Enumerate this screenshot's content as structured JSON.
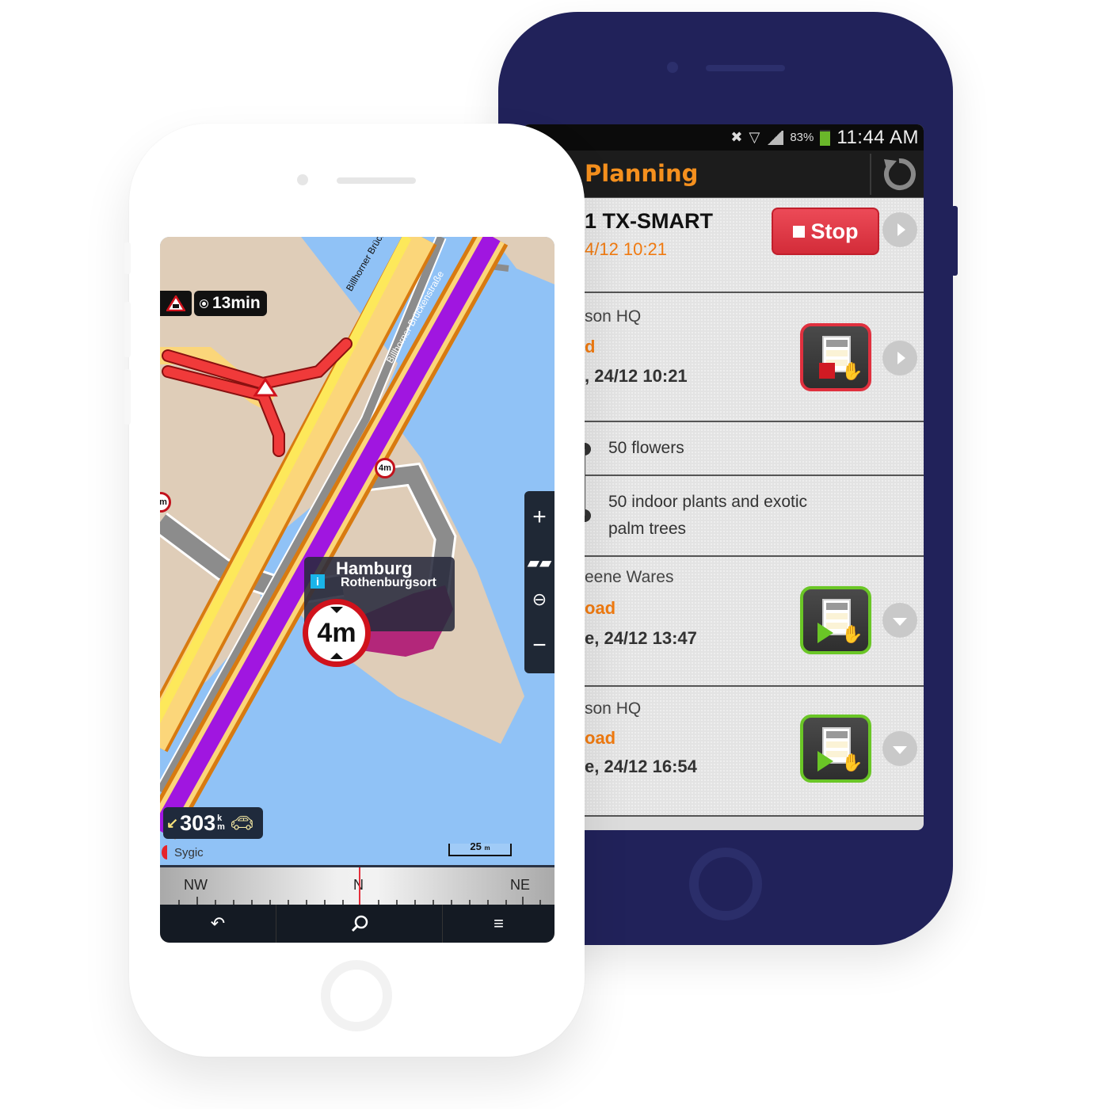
{
  "dark_phone": {
    "status_bar": {
      "icons": [
        "mute-icon",
        "wifi-icon",
        "signal-icon"
      ],
      "battery_percent": "83%",
      "time": "11:44 AM"
    },
    "title_bar": {
      "title": "Planning",
      "refresh_icon": "refresh-icon"
    },
    "vehicle_row": {
      "name": "1 TX-SMART",
      "timestamp": "4/12 10:21",
      "stop_label": "Stop"
    },
    "stops": [
      {
        "location": "son HQ",
        "action": "d",
        "datetime": ", 24/12 10:21",
        "icon_state": "stop",
        "chevron": "chevron-right-icon"
      },
      {
        "location": "eene Wares",
        "action": "oad",
        "datetime": "e, 24/12 13:47",
        "icon_state": "start",
        "chevron": "chevron-down-icon"
      },
      {
        "location": "son HQ",
        "action": "oad",
        "datetime": "e, 24/12 16:54",
        "icon_state": "start",
        "chevron": "chevron-down-icon"
      }
    ],
    "cargo_items": [
      {
        "text": "50 flowers"
      },
      {
        "text_line1": "50 indoor plants and exotic",
        "text_line2": "palm trees"
      }
    ]
  },
  "map_phone": {
    "traffic_delay": "13min",
    "road_labels": [
      "Billhorner Brückenstraße",
      "Billhorner Brückenstraße"
    ],
    "poi": {
      "city": "Hamburg",
      "district": "Rothenburgsort"
    },
    "height_limit": "4m",
    "small_sign_label": "4m",
    "remaining_distance": "303",
    "distance_unit_top": "k",
    "distance_unit_bottom": "m",
    "brand": "Sygic",
    "scale_label": "25",
    "scale_unit": "m",
    "compass": {
      "left": "NW",
      "center": "N",
      "right": "NE"
    },
    "zoom_controls": [
      "zoom-in-icon",
      "view-3d-icon",
      "zoom-out-magnifier-icon",
      "zoom-out-icon"
    ],
    "nav_buttons": [
      "back-icon",
      "search-icon",
      "menu-icon"
    ]
  },
  "colors": {
    "dark_phone_body": "#21225a",
    "planning_orange": "#f5901e",
    "stop_red": "#d32c39",
    "start_green": "#6ac626",
    "water": "#90c2f6",
    "land": "#dfcdb8",
    "route_purple": "#a016e0",
    "traffic_red": "#f03a3a",
    "highway_yellow": "#fde85a"
  }
}
